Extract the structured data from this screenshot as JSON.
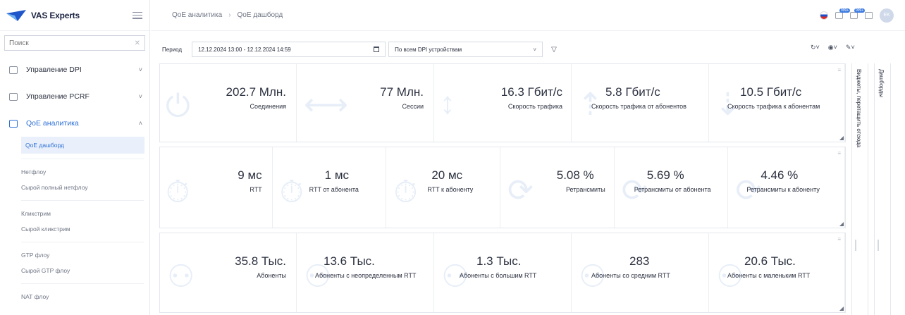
{
  "app": {
    "name": "VAS Experts"
  },
  "sidebar": {
    "search_placeholder": "Поиск",
    "groups": [
      {
        "label": "Управление DPI",
        "chevron": "˅"
      },
      {
        "label": "Управление PCRF",
        "chevron": "˅"
      },
      {
        "label": "QoE аналитика",
        "chevron": "˄"
      }
    ],
    "sub_items": [
      "QoE дашборд",
      "Нетфлоу",
      "Сырой полный нетфлоу",
      "Кликстрим",
      "Сырой кликстрим",
      "GTP флоу",
      "Сырой GTP флоу",
      "NAT флоу"
    ]
  },
  "header": {
    "breadcrumbs": [
      "QoE аналитика",
      "QoE дашборд"
    ],
    "avatar": "EK",
    "badges": [
      "999+",
      "999+"
    ]
  },
  "filters": {
    "period_label": "Период",
    "period_value": "12.12.2024 13:00 - 12.12.2024 14:59",
    "dpi_value": "По всем DPI устройствам"
  },
  "panels": {
    "row1": [
      {
        "value": "202.7 Млн.",
        "label": "Соединения",
        "icon": "plug-icon"
      },
      {
        "value": "77 Млн.",
        "label": "Сессии",
        "icon": "arrows-horizontal-icon"
      },
      {
        "value": "16.3 Гбит/с",
        "label": "Скорость трафика",
        "icon": "arrows-vertical-icon"
      },
      {
        "value": "5.8 Гбит/с",
        "label": "Скорость трафика от абонентов",
        "icon": "upload-icon"
      },
      {
        "value": "10.5 Гбит/с",
        "label": "Скорость трафика к абонентам",
        "icon": "download-icon"
      }
    ],
    "row2": [
      {
        "value": "9 мс",
        "label": "RTT",
        "icon": "stopwatch-icon"
      },
      {
        "value": "1 мс",
        "label": "RTT от абонента",
        "icon": "stopwatch-icon"
      },
      {
        "value": "20 мс",
        "label": "RTT к абоненту",
        "icon": "stopwatch-icon"
      },
      {
        "value": "5.08 %",
        "label": "Ретрансмиты",
        "icon": "retry-icon"
      },
      {
        "value": "5.69 %",
        "label": "Ретрансмиты от абонента",
        "icon": "retry-icon"
      },
      {
        "value": "4.46 %",
        "label": "Ретрансмиты к абоненту",
        "icon": "retry-icon"
      }
    ],
    "row3": [
      {
        "value": "35.8 Тыс.",
        "label": "Абоненты",
        "icon": "users-icon"
      },
      {
        "value": "13.6 Тыс.",
        "label": "Абоненты с неопределенным RTT",
        "icon": "users-icon"
      },
      {
        "value": "1.3 Тыс.",
        "label": "Абоненты с большим RTT",
        "icon": "users-icon"
      },
      {
        "value": "283",
        "label": "Абоненты со средним RTT",
        "icon": "users-icon"
      },
      {
        "value": "20.6 Тыс.",
        "label": "Абоненты с маленьким RTT",
        "icon": "users-icon"
      }
    ]
  },
  "side_panes": {
    "widgets": "Виджеты, перетащить отсюда",
    "dashboards": "Дашборды"
  }
}
